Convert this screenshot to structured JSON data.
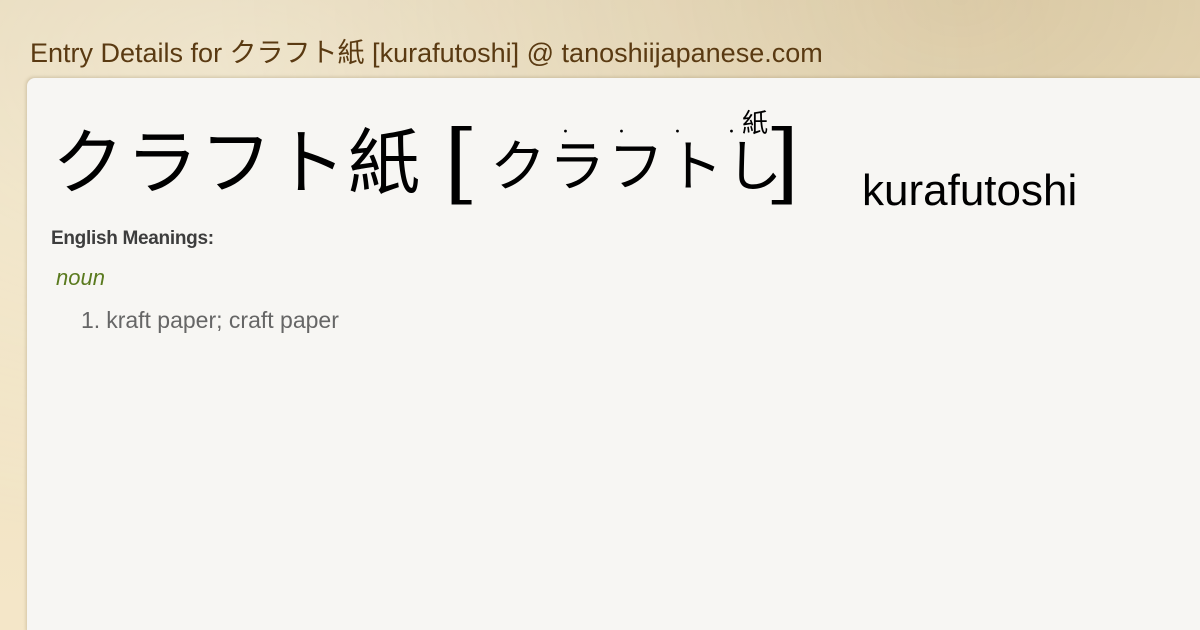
{
  "page": {
    "title": "Entry Details for クラフト紙 [kurafutoshi] @ tanoshiijapanese.com"
  },
  "entry": {
    "headword": "クラフト紙",
    "bracket_open": "[",
    "reading": "クラフトし",
    "bracket_close": "]",
    "ruby_dot": "·",
    "ruby_kanji": "紙",
    "romaji": "kurafutoshi"
  },
  "meanings": {
    "heading": "English Meanings:",
    "part_of_speech": "noun",
    "senses": [
      {
        "number": "1.",
        "text": "kraft paper; craft paper"
      }
    ]
  },
  "colors": {
    "title": "#5a3a12",
    "panel": "#f7f6f3",
    "pos": "#5a7a1e",
    "sense": "#666666",
    "heading": "#3d3d3d"
  }
}
